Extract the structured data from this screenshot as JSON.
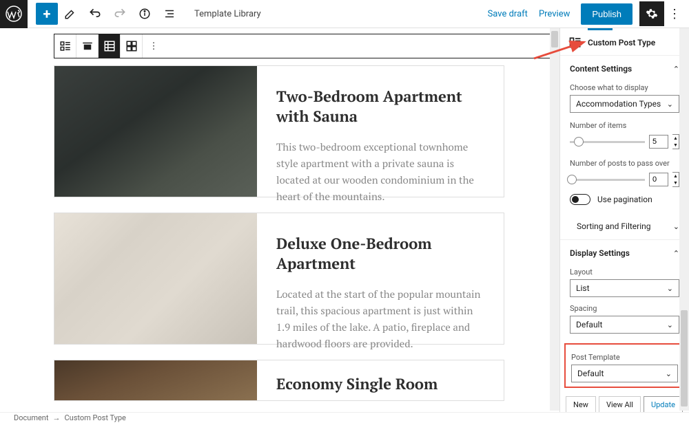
{
  "topbar": {
    "template_library": "Template Library",
    "save_draft": "Save draft",
    "preview": "Preview",
    "publish": "Publish"
  },
  "listings": [
    {
      "title": "Two-Bedroom Apartment with Sauna",
      "desc": "This two-bedroom exceptional townhome style apartment with a private sauna is located at our wooden condominium in the heart of the mountains."
    },
    {
      "title": "Deluxe One-Bedroom Apartment",
      "desc": "Located at the start of the popular mountain trail, this spacious apartment is just within 1.9 miles of the lake. A patio, fireplace and hardwood floors are provided."
    },
    {
      "title": "Economy Single Room",
      "desc": ""
    }
  ],
  "sidebar": {
    "block_name": "Custom Post Type",
    "content_settings": {
      "title": "Content Settings",
      "choose_label": "Choose what to display",
      "choose_value": "Accommodation Types",
      "num_items_label": "Number of items",
      "num_items_value": "5",
      "pass_over_label": "Number of posts to pass over",
      "pass_over_value": "0",
      "pagination_label": "Use pagination",
      "sort_filter": "Sorting and Filtering"
    },
    "display_settings": {
      "title": "Display Settings",
      "layout_label": "Layout",
      "layout_value": "List",
      "spacing_label": "Spacing",
      "spacing_value": "Default",
      "post_template_label": "Post Template",
      "post_template_value": "Default"
    },
    "buttons": {
      "new": "New",
      "view_all": "View All",
      "update": "Update"
    }
  },
  "statusbar": {
    "doc": "Document",
    "block": "Custom Post Type"
  }
}
